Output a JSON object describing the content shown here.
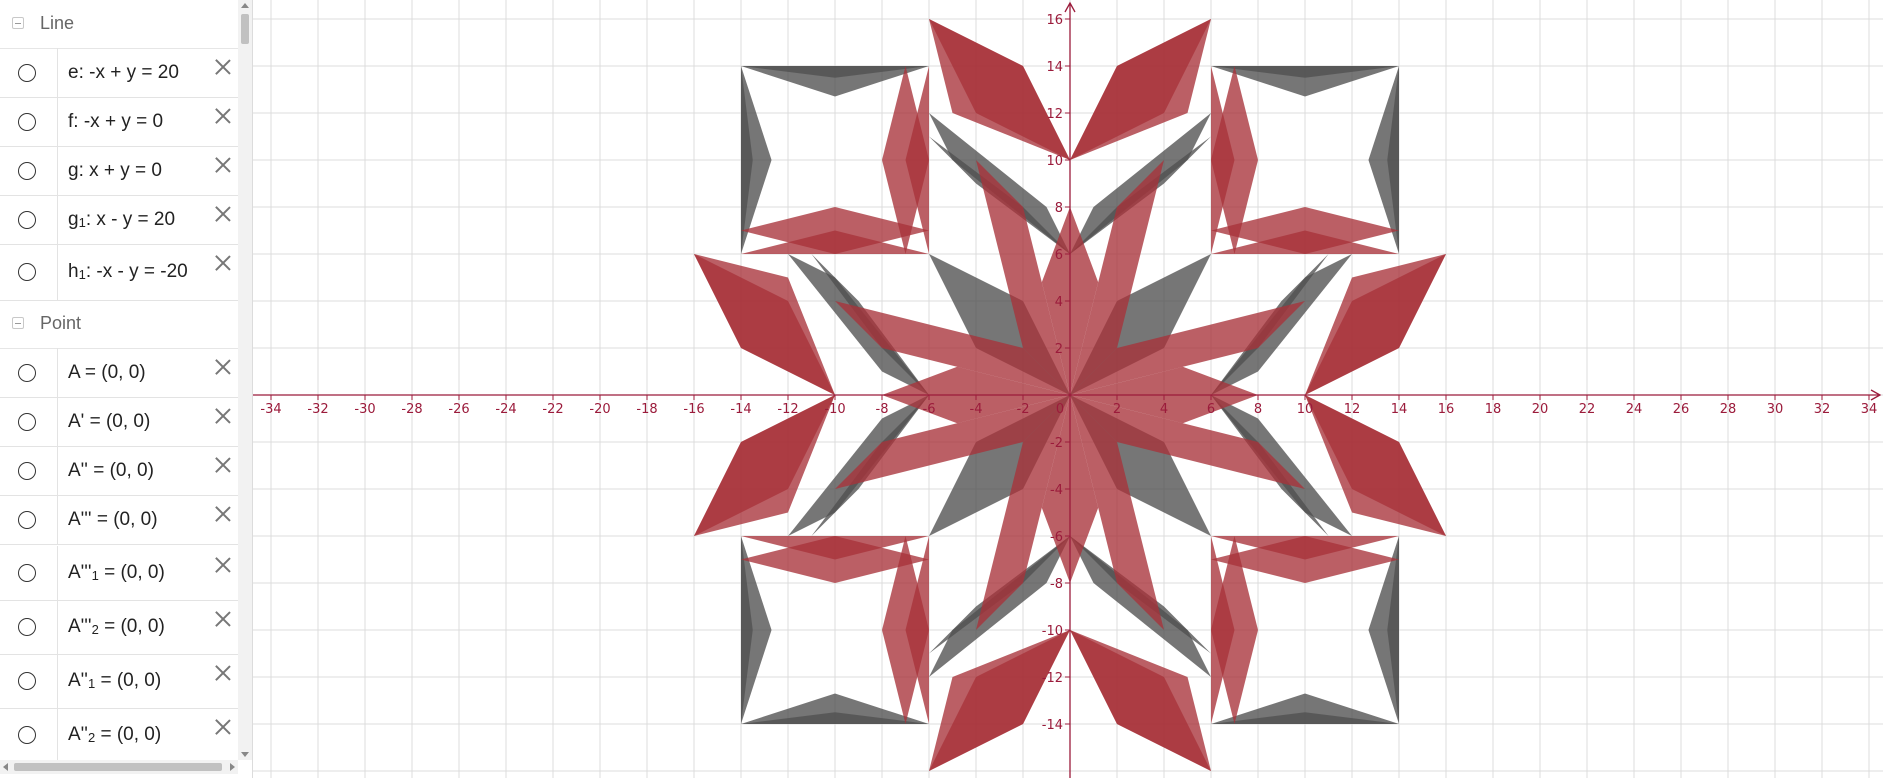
{
  "algebra": {
    "categories": {
      "line": {
        "label": "Line"
      },
      "point": {
        "label": "Point"
      }
    },
    "rows": [
      {
        "name": "e",
        "text": "e: -x + y = 20",
        "main": "e: -x + y = 20",
        "sub": "",
        "rest": ""
      },
      {
        "name": "f",
        "text": "f: -x + y = 0",
        "main": "f: -x + y = 0",
        "sub": "",
        "rest": ""
      },
      {
        "name": "g",
        "text": "g: x + y = 0",
        "main": "g: x + y = 0",
        "sub": "",
        "rest": ""
      },
      {
        "name": "g1",
        "text": "g1: x - y = 20",
        "main": "g",
        "sub": "1",
        "rest": ": x - y = 20"
      },
      {
        "name": "h1",
        "text": "h1: -x - y = -20",
        "main": "h",
        "sub": "1",
        "rest": ": -x - y = -20"
      },
      {
        "name": "A",
        "text": "A = (0, 0)",
        "main": "A = (0, 0)",
        "sub": "",
        "rest": ""
      },
      {
        "name": "A-prime",
        "text": "A' = (0, 0)",
        "main": "A' = (0, 0)",
        "sub": "",
        "rest": ""
      },
      {
        "name": "A-double-prime",
        "text": "A'' = (0, 0)",
        "main": "A'' = (0, 0)",
        "sub": "",
        "rest": ""
      },
      {
        "name": "A-triple-prime",
        "text": "A''' = (0, 0)",
        "main": "A''' = (0, 0)",
        "sub": "",
        "rest": ""
      },
      {
        "name": "A-triple-prime-1",
        "text": "A'''1 = (0, 0)",
        "main": "A'''",
        "sub": "1",
        "rest": " = (0, 0)"
      },
      {
        "name": "A-triple-prime-2",
        "text": "A'''2 = (0, 0)",
        "main": "A'''",
        "sub": "2",
        "rest": " = (0, 0)"
      },
      {
        "name": "A-double-prime-1",
        "text": "A''1 = (0, 0)",
        "main": "A''",
        "sub": "1",
        "rest": " = (0, 0)"
      },
      {
        "name": "A-double-prime-2",
        "text": "A''2 = (0, 0)",
        "main": "A''",
        "sub": "2",
        "rest": " = (0, 0)"
      }
    ]
  },
  "graph": {
    "axis_color": "#9b1b3b",
    "grid_color": "#dcdcdc",
    "x_range": [
      -35,
      36
    ],
    "y_range": [
      -16,
      16.7
    ],
    "tick_step": 2,
    "x_ticks": [
      "-34",
      "-32",
      "-30",
      "-28",
      "-26",
      "-24",
      "-22",
      "-20",
      "-18",
      "-16",
      "-14",
      "-12",
      "-10",
      "-8",
      "-6",
      "-4",
      "-2",
      "0",
      "2",
      "4",
      "6",
      "8",
      "10",
      "12",
      "14",
      "16",
      "18",
      "20",
      "22",
      "24",
      "26",
      "28",
      "30",
      "32",
      "34"
    ],
    "y_ticks": [
      "-14",
      "-12",
      "-10",
      "-8",
      "-6",
      "-4",
      "-2",
      "2",
      "4",
      "6",
      "8",
      "10",
      "12",
      "14",
      "16"
    ],
    "colors": {
      "red": "#a8323a",
      "gray": "#4f4f4f"
    },
    "base_shapes": {
      "red": [
        [
          [
            0,
            0
          ],
          [
            2,
            2
          ],
          [
            10,
            4
          ],
          [
            8,
            2
          ]
        ],
        [
          [
            0,
            0
          ],
          [
            1.2,
            4.8
          ],
          [
            0,
            8
          ],
          [
            -1.2,
            4.8
          ]
        ],
        [
          [
            10,
            0
          ],
          [
            12,
            5
          ],
          [
            16,
            6
          ],
          [
            14,
            2
          ]
        ],
        [
          [
            0,
            10
          ],
          [
            2,
            14
          ],
          [
            6,
            16
          ],
          [
            4,
            12
          ]
        ],
        [
          [
            7,
            6
          ],
          [
            8,
            10
          ],
          [
            7,
            14
          ],
          [
            6,
            10
          ]
        ],
        [
          [
            6,
            6
          ],
          [
            10,
            7
          ],
          [
            14,
            6
          ]
        ]
      ],
      "gray": [
        [
          [
            0,
            0
          ],
          [
            4,
            2
          ],
          [
            6,
            6
          ],
          [
            2,
            4
          ]
        ],
        [
          [
            0,
            6
          ],
          [
            2,
            8
          ],
          [
            6,
            11
          ],
          [
            4,
            9
          ]
        ],
        [
          [
            6,
            0
          ],
          [
            8,
            1
          ],
          [
            12,
            6
          ],
          [
            10,
            5
          ]
        ],
        [
          [
            14,
            6
          ],
          [
            13.5,
            10
          ],
          [
            14,
            14
          ]
        ],
        [
          [
            6,
            14
          ],
          [
            10,
            12.7
          ],
          [
            14,
            14
          ]
        ]
      ]
    }
  }
}
